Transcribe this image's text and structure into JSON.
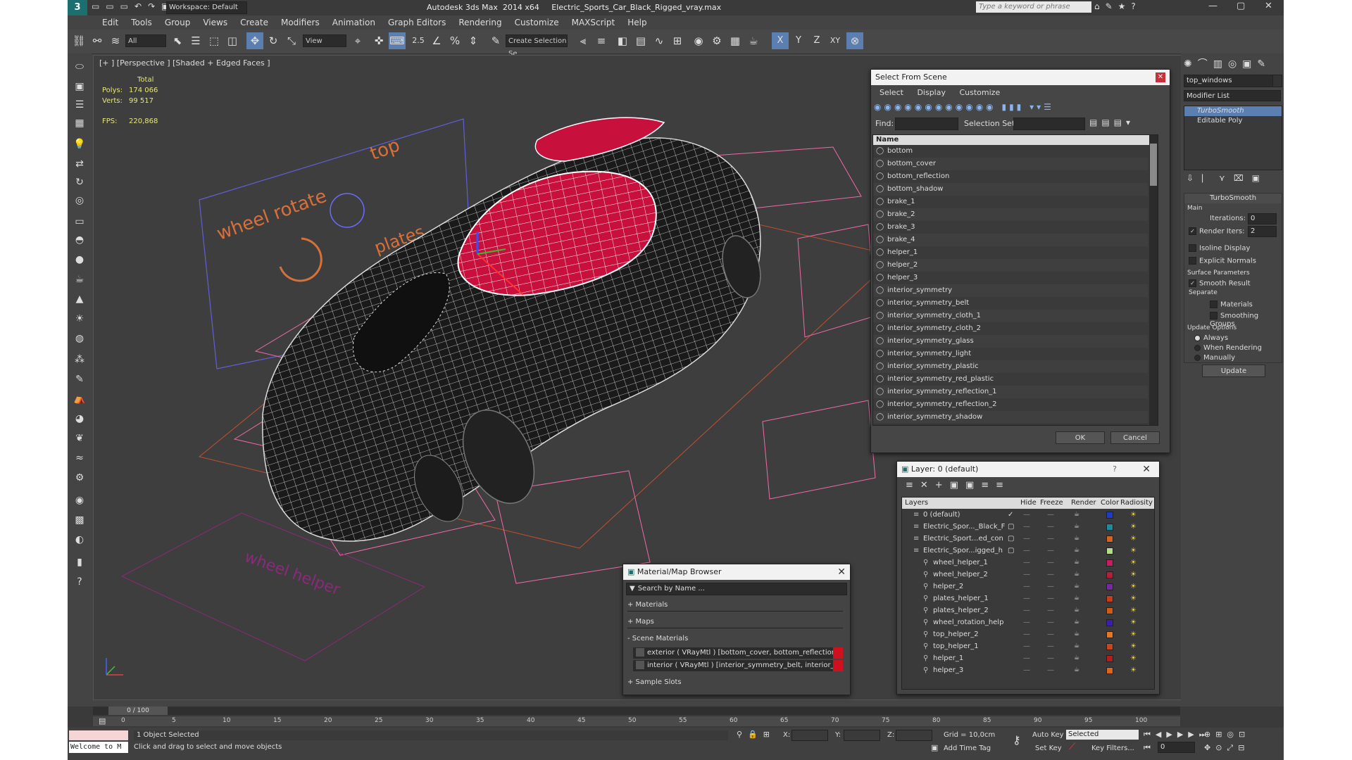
{
  "window": {
    "workspace_label": "Workspace: Default",
    "title": "Autodesk 3ds Max  2014 x64     Electric_Sports_Car_Black_Rigged_vray.max",
    "search_placeholder": "Type a keyword or phrase"
  },
  "menu": [
    "Edit",
    "Tools",
    "Group",
    "Views",
    "Create",
    "Modifiers",
    "Animation",
    "Graph Editors",
    "Rendering",
    "Customize",
    "MAXScript",
    "Help"
  ],
  "toolbar": {
    "filter": "All",
    "refcoord": "View",
    "selection_set": "Create Selection Se",
    "snap_angle": "2.5",
    "axis": [
      "X",
      "Y",
      "Z",
      "XY"
    ]
  },
  "viewport": {
    "label": "[+ ] [Perspective ] [Shaded + Edged Faces ]",
    "stats": {
      "total": "Total",
      "polys_label": "Polys:",
      "polys": "174 066",
      "verts_label": "Verts:",
      "verts": "99 517",
      "fps_label": "FPS:",
      "fps": "220,868"
    },
    "helper_text": [
      "wheel rotate",
      "top",
      "plates",
      "wheel helper"
    ]
  },
  "select_scene": {
    "title": "Select From Scene",
    "menu": [
      "Select",
      "Display",
      "Customize"
    ],
    "find_label": "Find:",
    "selset_label": "Selection Set:",
    "col_name": "Name",
    "items": [
      "bottom",
      "bottom_cover",
      "bottom_reflection",
      "bottom_shadow",
      "brake_1",
      "brake_2",
      "brake_3",
      "brake_4",
      "helper_1",
      "helper_2",
      "helper_3",
      "interior_symmetry",
      "interior_symmetry_belt",
      "interior_symmetry_cloth_1",
      "interior_symmetry_cloth_2",
      "interior_symmetry_glass",
      "interior_symmetry_light",
      "interior_symmetry_plastic",
      "interior_symmetry_red_plastic",
      "interior_symmetry_reflection_1",
      "interior_symmetry_reflection_2",
      "interior_symmetry_shadow"
    ],
    "ok": "OK",
    "cancel": "Cancel"
  },
  "layer": {
    "title": "Layer: 0 (default)",
    "help": "?",
    "cols": [
      "Layers",
      "Hide",
      "Freeze",
      "Render",
      "Color",
      "Radiosity"
    ],
    "rows": [
      {
        "name": "0 (default)",
        "color": "#1e3cc8",
        "indent": 0
      },
      {
        "name": "Electric_Spor..._Black_F",
        "color": "#1e8ca0",
        "indent": 0
      },
      {
        "name": "Electric_Sport...ed_con",
        "color": "#d2641e",
        "indent": 0
      },
      {
        "name": "Electric_Spor...igged_h",
        "color": "#b4dc8c",
        "indent": 0
      },
      {
        "name": "wheel_helper_1",
        "color": "#c81e64",
        "indent": 1
      },
      {
        "name": "wheel_helper_2",
        "color": "#b41e3c",
        "indent": 1
      },
      {
        "name": "helper_2",
        "color": "#7828a0",
        "indent": 1
      },
      {
        "name": "plates_helper_1",
        "color": "#c83c1e",
        "indent": 1
      },
      {
        "name": "plates_helper_2",
        "color": "#d25a14",
        "indent": 1
      },
      {
        "name": "wheel_rotation_help",
        "color": "#3c1eb4",
        "indent": 1
      },
      {
        "name": "top_helper_2",
        "color": "#e6781e",
        "indent": 1
      },
      {
        "name": "top_helper_1",
        "color": "#c8461e",
        "indent": 1
      },
      {
        "name": "helper_1",
        "color": "#b41e1e",
        "indent": 1
      },
      {
        "name": "helper_3",
        "color": "#dc641e",
        "indent": 1
      }
    ]
  },
  "material_browser": {
    "title": "Material/Map Browser",
    "search": "Search by Name ...",
    "sections": [
      "+ Materials",
      "+ Maps",
      "- Scene Materials"
    ],
    "materials": [
      "exterior  ( VRayMtl ) [bottom_cover, bottom_reflection, bottom_sha...",
      "interior  ( VRayMtl ) [interior_symmetry_belt, interior_symmetry_clo..."
    ],
    "sample_slots": "+ Sample Slots"
  },
  "command_panel": {
    "object_name": "top_windows",
    "modifier_list": "Modifier List",
    "stack": [
      "TurboSmooth",
      "Editable Poly"
    ],
    "rollout": "TurboSmooth",
    "main": "Main",
    "iterations_label": "Iterations:",
    "iterations": "0",
    "render_iters_label": "Render Iters:",
    "render_iters": "2",
    "isoline": "Isoline Display",
    "explicit": "Explicit Normals",
    "surface_params": "Surface Parameters",
    "smooth_result": "Smooth Result",
    "separate": "Separate",
    "materials": "Materials",
    "smoothing": "Smoothing Groups",
    "update_options": "Update Options",
    "always": "Always",
    "when_rendering": "When Rendering",
    "manually": "Manually",
    "update": "Update"
  },
  "timeline": {
    "frame": "0 / 100",
    "ticks": [
      "0",
      "5",
      "10",
      "15",
      "20",
      "25",
      "30",
      "35",
      "40",
      "45",
      "50",
      "55",
      "60",
      "65",
      "70",
      "75",
      "80",
      "85",
      "90",
      "95",
      "100"
    ]
  },
  "status": {
    "welcome": "Welcome to M",
    "selected": "1 Object Selected",
    "prompt": "Click and drag to select and move objects",
    "x_label": "X:",
    "y_label": "Y:",
    "z_label": "Z:",
    "grid": "Grid = 10,0cm",
    "add_time_tag": "Add Time Tag",
    "auto_key": "Auto Key",
    "set_key": "Set Key",
    "selected_dropdown": "Selected",
    "key_filters": "Key Filters...",
    "frame_value": "0"
  }
}
